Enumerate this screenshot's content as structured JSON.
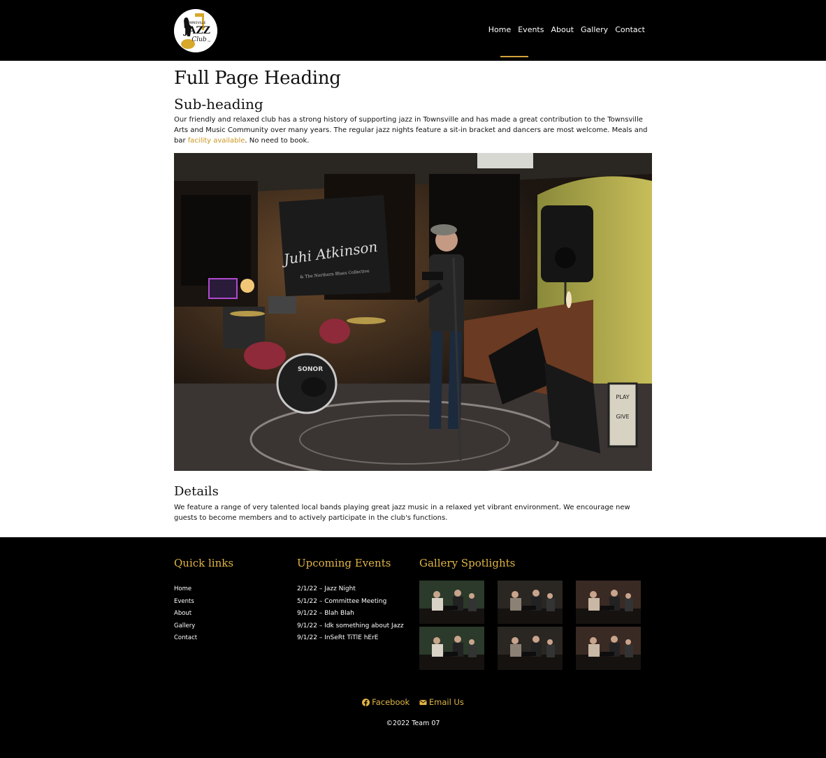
{
  "header": {
    "logo": {
      "line1": "TOWNSVILLE",
      "line2": "JAZZ",
      "line3": "Club",
      "line4": "inc"
    },
    "nav": [
      {
        "label": "Home",
        "active": true
      },
      {
        "label": "Events",
        "active": false
      },
      {
        "label": "About",
        "active": false
      },
      {
        "label": "Gallery",
        "active": false
      },
      {
        "label": "Contact",
        "active": false
      }
    ],
    "accent_color": "#d4a23a"
  },
  "main": {
    "title": "Full Page Heading",
    "subtitle": "Sub-heading",
    "intro_text": "Our friendly and relaxed club has a strong history of supporting jazz in Townsville and has made a great contribution to the Townsville Arts and Music Community over many years. The regular jazz nights feature a sit-in bracket and dancers are most welcome. Meals and bar ",
    "intro_link": "facility available",
    "intro_after": ". No need to book.",
    "photo": {
      "banner_text": "Juhi Atkinson",
      "banner_sub": "& The Northern Blues Collective",
      "drum_brand": "SONOR",
      "sign_lines": [
        "PLAY",
        "GIVE"
      ]
    },
    "details_heading": "Details",
    "details_text": "We feature a range of very talented local bands playing great jazz music in a relaxed yet vibrant environment. We encourage new guests to become members and to actively participate in the club's functions."
  },
  "footer": {
    "quick_links_title": "Quick links",
    "quick_links": [
      "Home",
      "Events",
      "About",
      "Gallery",
      "Contact"
    ],
    "events_title": "Upcoming Events",
    "events": [
      "2/1/22 – Jazz Night",
      "5/1/22 – Committee Meeting",
      "9/1/22 – Blah Blah",
      "9/1/22 – Idk something about Jazz",
      "9/1/22 – InSeRt TiTlE hErE"
    ],
    "gallery_title": "Gallery Spotlights",
    "social": {
      "facebook": "Facebook",
      "email": "Email Us"
    },
    "copyright": "©2022 Team 07",
    "title_color": "#e0b545"
  }
}
